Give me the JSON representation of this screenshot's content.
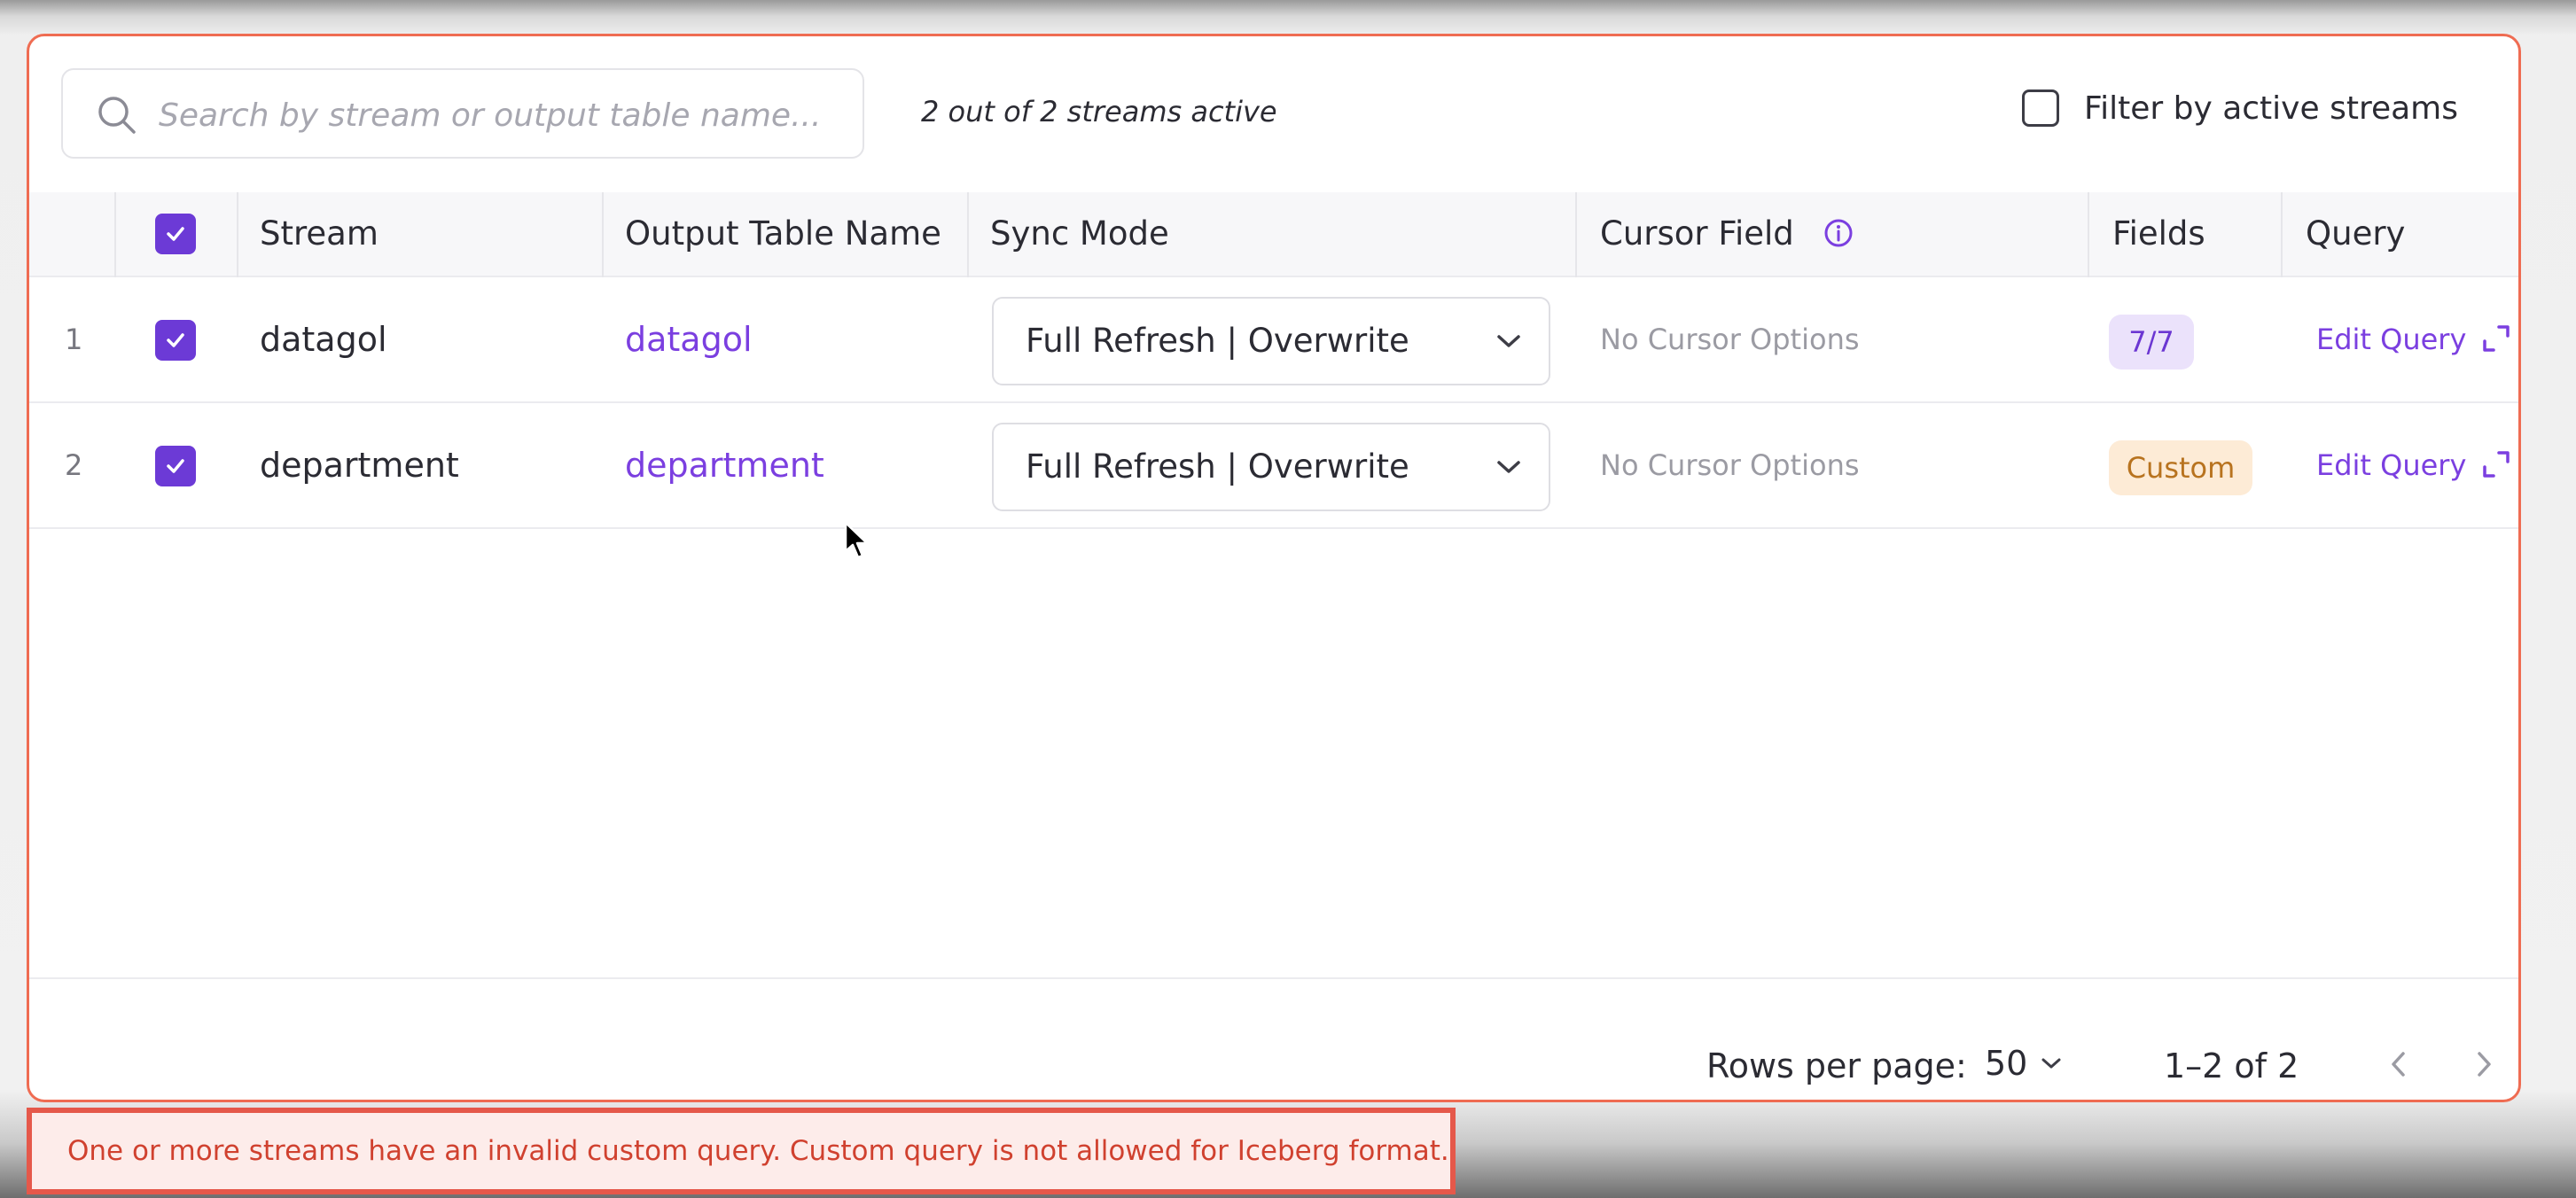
{
  "search": {
    "placeholder": "Search by stream or output table name...",
    "icon": "search-icon"
  },
  "status": {
    "active_count": "2 out of 2 streams active"
  },
  "filter": {
    "label": "Filter by active streams",
    "checked": false
  },
  "table": {
    "select_all_checked": true,
    "headers": {
      "stream": "Stream",
      "output_table": "Output Table Name",
      "sync_mode": "Sync Mode",
      "cursor_field": "Cursor Field",
      "fields": "Fields",
      "query": "Query"
    },
    "rows": [
      {
        "index": "1",
        "checked": true,
        "stream": "datagol",
        "output_table": "datagol",
        "sync_mode": "Full Refresh | Overwrite",
        "cursor": "No Cursor Options",
        "fields": "7/7",
        "query_action": "Edit Query"
      },
      {
        "index": "2",
        "checked": true,
        "stream": "department",
        "output_table": "department",
        "sync_mode": "Full Refresh | Overwrite",
        "cursor": "No Cursor Options",
        "fields": "Custom",
        "query_action": "Edit Query"
      }
    ]
  },
  "pagination": {
    "rows_per_page_label": "Rows per page:",
    "rows_per_page_value": "50",
    "range": "1–2 of 2"
  },
  "error": {
    "message": "One or more streams have an invalid custom query. Custom query is not allowed for Iceberg format."
  },
  "colors": {
    "accent": "#6c3ad6",
    "link": "#7b3fe0",
    "error": "#d0412f",
    "panel_border": "#ef6c52",
    "custom_badge_bg": "#fdebd6",
    "custom_badge_text": "#b8731f",
    "count_badge_bg": "#ebe2fb"
  }
}
